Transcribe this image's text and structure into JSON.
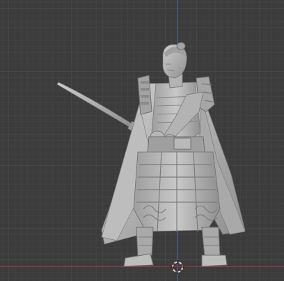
{
  "viewport": {
    "mode": "3d-viewport",
    "background_color": "#3c3c3c",
    "grid_color": "#464646",
    "axis_x_color": "#9a3c46",
    "axis_y_color": "#4d6ea8",
    "model_color": "#b9b9b9",
    "object": "samurai-figure-mesh",
    "cursor_icon": "3d-cursor-icon"
  }
}
